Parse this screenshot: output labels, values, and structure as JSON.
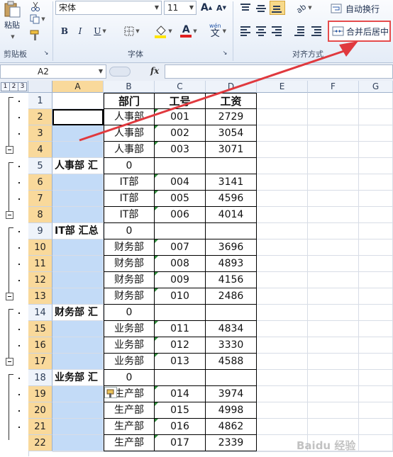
{
  "ribbon": {
    "paste_label": "粘贴",
    "clipboard_label": "剪贴板",
    "font_group_label": "字体",
    "align_group_label": "对齐方式",
    "font_name": "宋体",
    "font_size": "11",
    "bold": "B",
    "italic": "I",
    "underline": "U",
    "font_color_letter": "A",
    "wrap_text_label": "自动换行",
    "merge_center_label": "合并后居中",
    "grow_font": "A",
    "shrink_font": "A",
    "wen": "wén"
  },
  "formula_bar": {
    "name_box": "A2",
    "fx": "fx",
    "value": ""
  },
  "columns": [
    "A",
    "B",
    "C",
    "D",
    "E",
    "F",
    "G"
  ],
  "outline_levels": [
    "1",
    "2",
    "3"
  ],
  "rows": [
    {
      "n": "1",
      "a": "",
      "b": "部门",
      "c": "工号",
      "d": "工资"
    },
    {
      "n": "2",
      "a": "",
      "b": "人事部",
      "c": "001",
      "d": "2729"
    },
    {
      "n": "3",
      "a": "",
      "b": "人事部",
      "c": "002",
      "d": "3054"
    },
    {
      "n": "4",
      "a": "",
      "b": "人事部",
      "c": "003",
      "d": "3071"
    },
    {
      "n": "5",
      "a": "人事部 汇",
      "b": "0",
      "c": "",
      "d": ""
    },
    {
      "n": "6",
      "a": "",
      "b": "IT部",
      "c": "004",
      "d": "3141"
    },
    {
      "n": "7",
      "a": "",
      "b": "IT部",
      "c": "005",
      "d": "4596"
    },
    {
      "n": "8",
      "a": "",
      "b": "IT部",
      "c": "006",
      "d": "4014"
    },
    {
      "n": "9",
      "a": "IT部 汇总",
      "b": "0",
      "c": "",
      "d": ""
    },
    {
      "n": "10",
      "a": "",
      "b": "财务部",
      "c": "007",
      "d": "3696"
    },
    {
      "n": "11",
      "a": "",
      "b": "财务部",
      "c": "008",
      "d": "4893"
    },
    {
      "n": "12",
      "a": "",
      "b": "财务部",
      "c": "009",
      "d": "4156"
    },
    {
      "n": "13",
      "a": "",
      "b": "财务部",
      "c": "010",
      "d": "2486"
    },
    {
      "n": "14",
      "a": "财务部 汇",
      "b": "0",
      "c": "",
      "d": ""
    },
    {
      "n": "15",
      "a": "",
      "b": "业务部",
      "c": "011",
      "d": "4834"
    },
    {
      "n": "16",
      "a": "",
      "b": "业务部",
      "c": "012",
      "d": "3330"
    },
    {
      "n": "17",
      "a": "",
      "b": "业务部",
      "c": "013",
      "d": "4588"
    },
    {
      "n": "18",
      "a": "业务部 汇",
      "b": "0",
      "c": "",
      "d": ""
    },
    {
      "n": "19",
      "a": "",
      "b": "生产部",
      "c": "014",
      "d": "3974"
    },
    {
      "n": "20",
      "a": "",
      "b": "生产部",
      "c": "015",
      "d": "4998"
    },
    {
      "n": "21",
      "a": "",
      "b": "生产部",
      "c": "016",
      "d": "4862"
    },
    {
      "n": "22",
      "a": "",
      "b": "生产部",
      "c": "017",
      "d": "2339"
    }
  ],
  "colors": {
    "selection": "#c3dbf7",
    "header_selected": "#f9d99b",
    "annotation_arrow": "#e0393e"
  },
  "watermark_text": "Baidu 经验"
}
